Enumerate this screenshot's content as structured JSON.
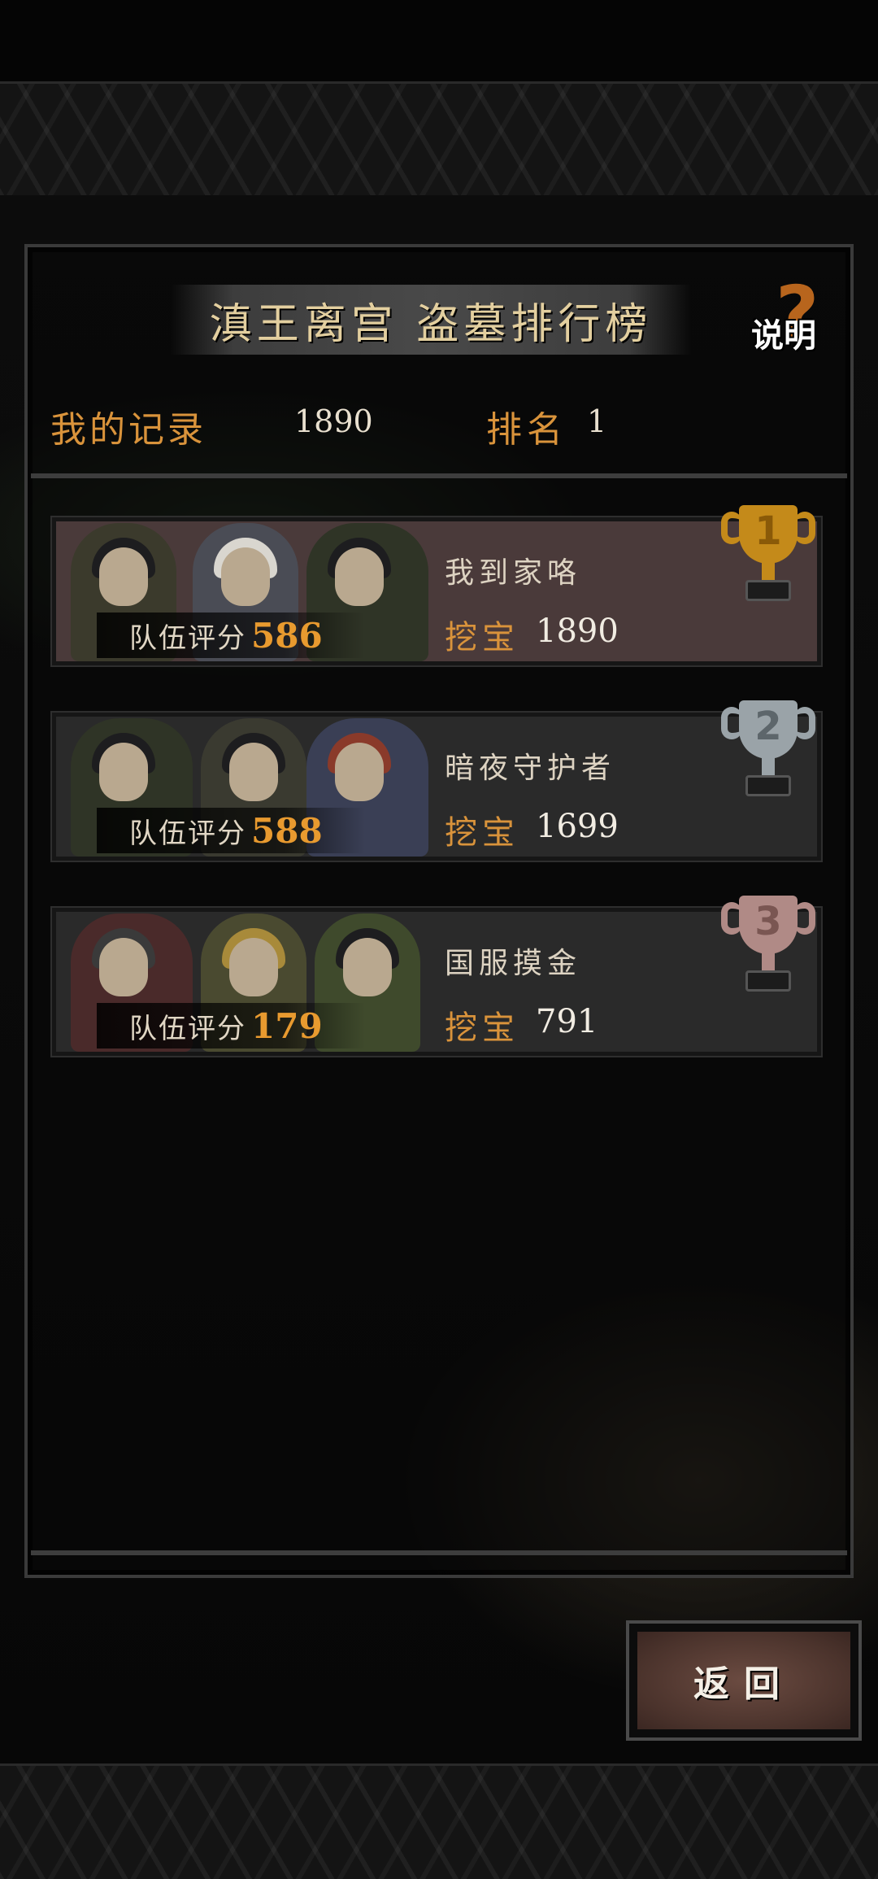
{
  "header": {
    "title": "滇王离宫 盗墓排行榜",
    "help_label": "说明",
    "help_symbol": "?"
  },
  "my_record": {
    "label": "我的记录",
    "value": "1890",
    "rank_label": "排名",
    "rank_value": "1"
  },
  "entries": [
    {
      "rank": "1",
      "trophy": "gold-trophy-icon",
      "team_score_label": "队伍评分",
      "team_score": "586",
      "player_name": "我到家咯",
      "dig_label": "挖宝",
      "dig_value": "1890"
    },
    {
      "rank": "2",
      "trophy": "silver-trophy-icon",
      "team_score_label": "队伍评分",
      "team_score": "588",
      "player_name": "暗夜守护者",
      "dig_label": "挖宝",
      "dig_value": "1699"
    },
    {
      "rank": "3",
      "trophy": "bronze-trophy-icon",
      "team_score_label": "队伍评分",
      "team_score": "179",
      "player_name": "国服摸金",
      "dig_label": "挖宝",
      "dig_value": "791"
    }
  ],
  "footer": {
    "back_label": "返回"
  },
  "colors": {
    "accent_orange": "#d9933b",
    "score_orange": "#e89a2f",
    "first_row_bg": "#4a3a3a",
    "row_bg": "#2a2a2a",
    "gold": "#c48a1a",
    "silver": "#9aa3a8",
    "bronze": "#b08a86"
  }
}
